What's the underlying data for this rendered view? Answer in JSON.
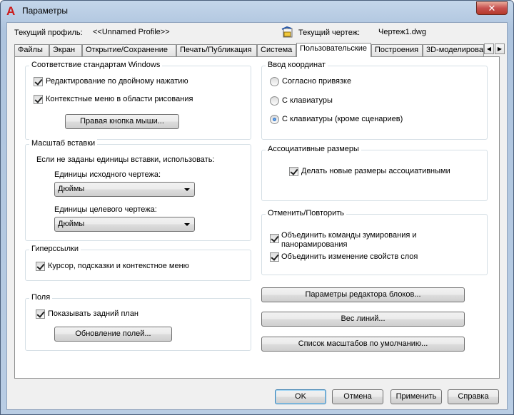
{
  "window": {
    "title": "Параметры",
    "close_glyph": "✕"
  },
  "profile": {
    "label": "Текущий профиль:",
    "value": "<<Unnamed Profile>>",
    "drawing_label": "Текущий чертеж:",
    "drawing_value": "Чертеж1.dwg"
  },
  "tabs": [
    {
      "label": "Файлы"
    },
    {
      "label": "Экран"
    },
    {
      "label": "Открытие/Сохранение"
    },
    {
      "label": "Печать/Публикация"
    },
    {
      "label": "Система"
    },
    {
      "label": "Пользовательские"
    },
    {
      "label": "Построения"
    },
    {
      "label": "3D-моделирова"
    }
  ],
  "tab_scroll": {
    "left": "◀",
    "right": "▶"
  },
  "standards": {
    "title": "Соответствие стандартам Windows",
    "dblclick_label": "Редактирование по двойному нажатию",
    "context_label": "Контекстные меню в области рисования",
    "rmb_button": "Правая кнопка мыши..."
  },
  "insert_scale": {
    "title": "Масштаб вставки",
    "hint": "Если не заданы единицы вставки, использовать:",
    "source_label": "Единицы исходного чертежа:",
    "source_value": "Дюймы",
    "target_label": "Единицы целевого чертежа:",
    "target_value": "Дюймы"
  },
  "hyperlinks": {
    "title": "Гиперссылки",
    "cursor_label": "Курсор, подсказки и контекстное меню"
  },
  "fields": {
    "title": "Поля",
    "background_label": "Показывать задний план",
    "update_button": "Обновление полей..."
  },
  "coord_input": {
    "title": "Ввод координат",
    "option1": "Согласно привязке",
    "option2": "С клавиатуры",
    "option3": "С клавиатуры (кроме сценариев)"
  },
  "assoc_dims": {
    "title": "Ассоциативные размеры",
    "make_assoc_label": "Делать новые размеры ассоциативными"
  },
  "undo_redo": {
    "title": "Отменить/Повторить",
    "combine_zoom_label": "Объединить команды зумирования и",
    "combine_zoom_label2": "панорамирования",
    "combine_props_label": "Объединить изменение свойств слоя"
  },
  "right_buttons": {
    "block_editor": "Параметры редактора блоков...",
    "lineweight": "Вес линий...",
    "scale_list": "Список масштабов по умолчанию..."
  },
  "footer": {
    "ok": "OK",
    "cancel": "Отмена",
    "apply": "Применить",
    "help": "Справка"
  }
}
